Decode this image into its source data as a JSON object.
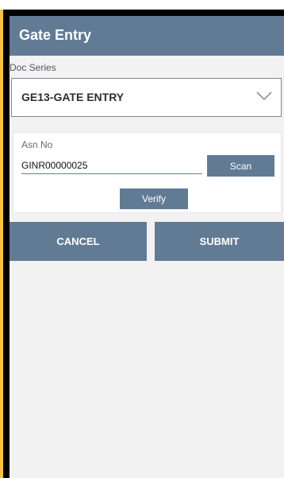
{
  "app": {
    "title": "Gate Entry"
  },
  "doc_series": {
    "label": "Doc Series",
    "value": "GE13-GATE ENTRY"
  },
  "asn": {
    "label": "Asn No",
    "value": "GINR00000025",
    "scan_label": "Scan",
    "verify_label": "Verify"
  },
  "actions": {
    "cancel_label": "CANCEL",
    "submit_label": "SUBMIT"
  },
  "colors": {
    "accent": "#627b94",
    "background": "#f2f2f2",
    "outer": "#f7c340"
  },
  "icons": {
    "dropdown": "chevron-down-icon"
  }
}
